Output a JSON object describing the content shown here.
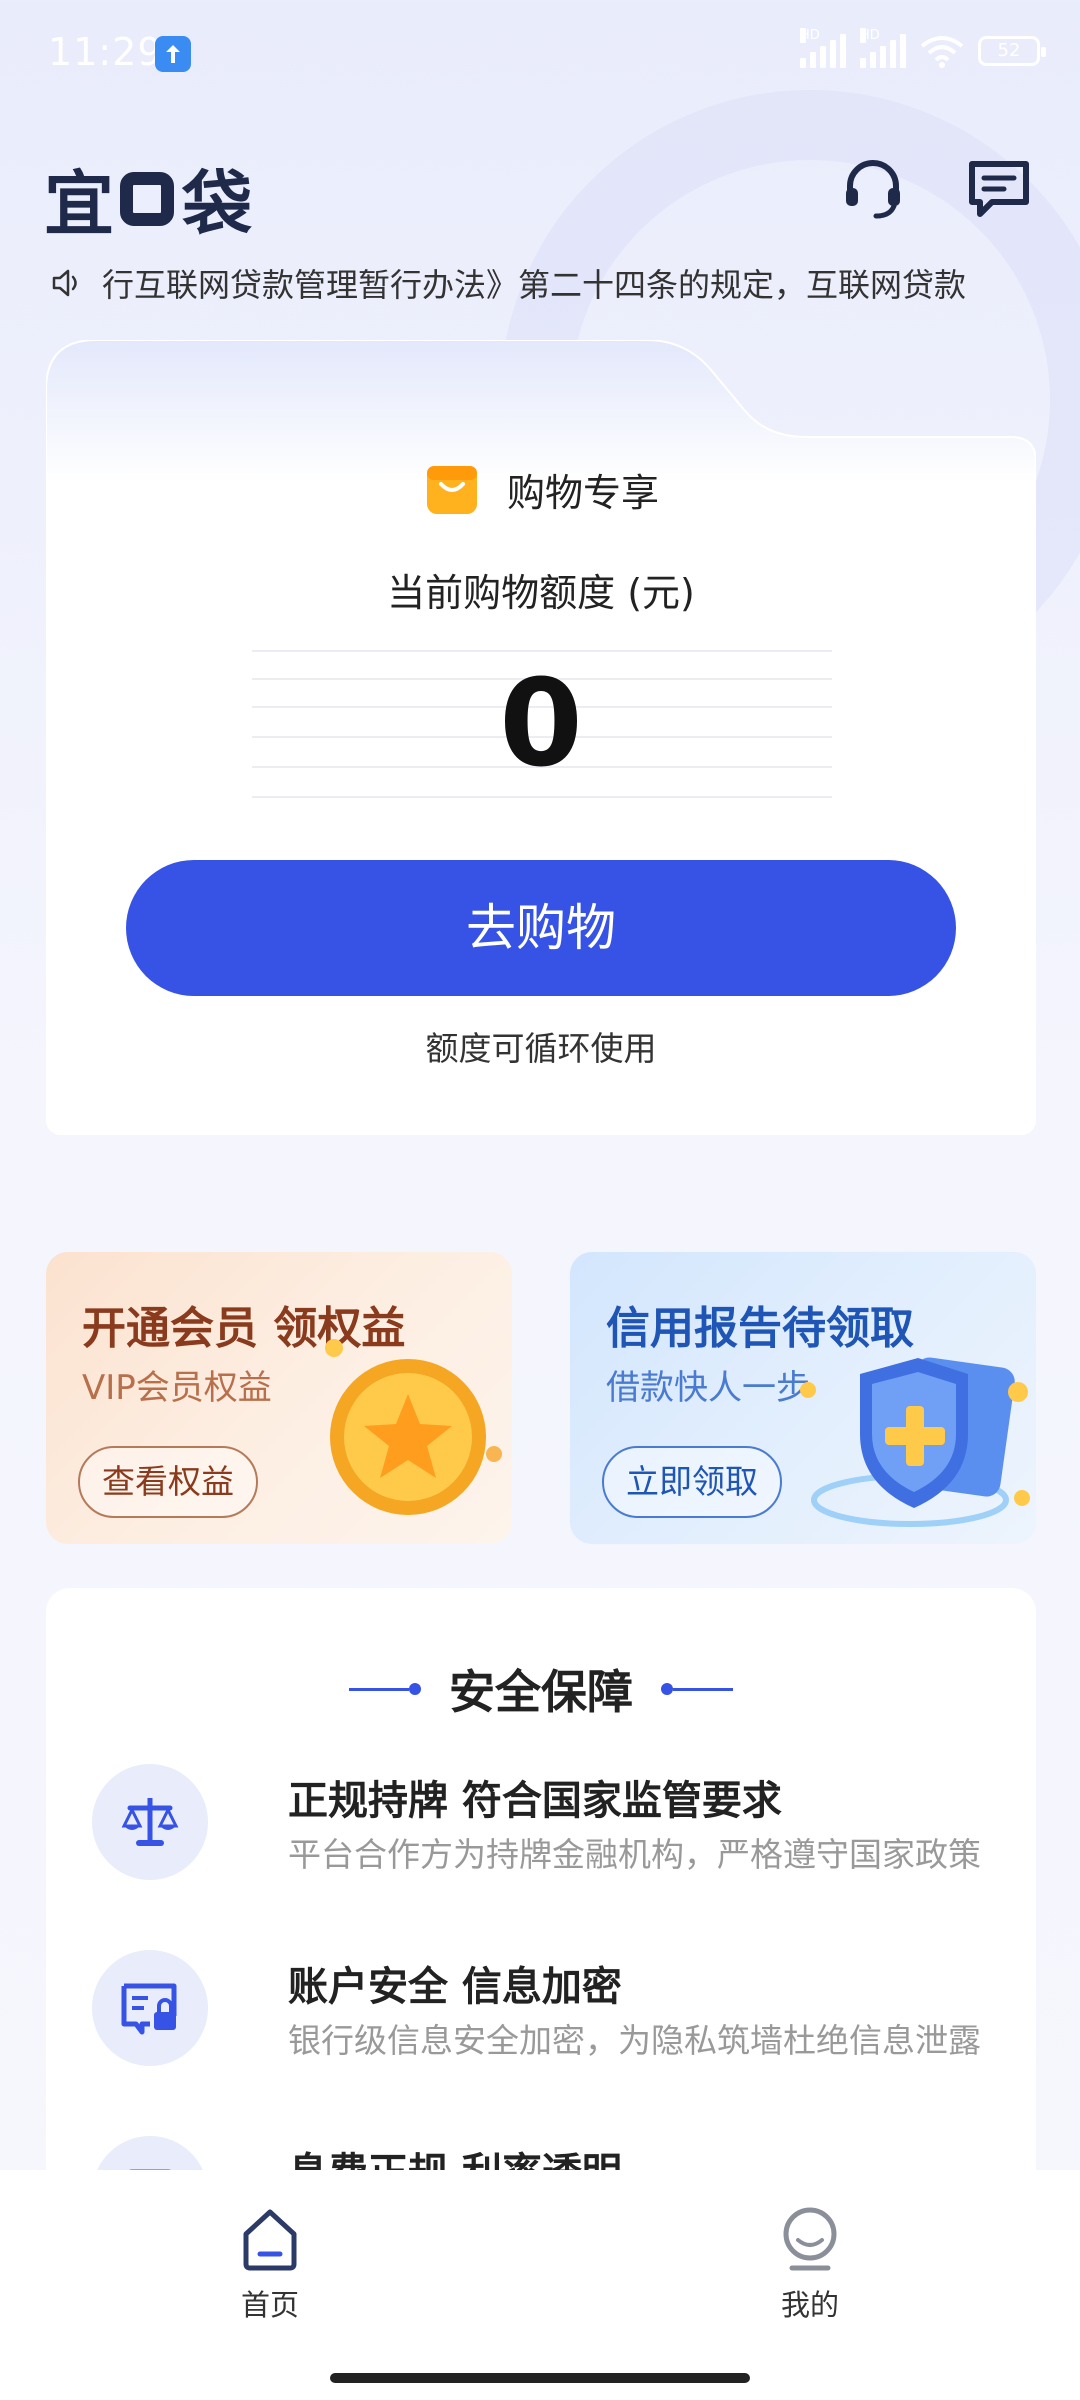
{
  "status_bar": {
    "time": "11:29",
    "battery": "52",
    "signal_1_label": "HD",
    "signal_2_label": "HD"
  },
  "header": {
    "logo_left": "宜",
    "logo_right": "袋",
    "icons": [
      "headset-icon",
      "message-icon"
    ]
  },
  "notice": {
    "text": "行互联网贷款管理暂行办法》第二十四条的规定，互联网贷款"
  },
  "quota_card": {
    "tag_label": "购物专享",
    "title": "当前购物额度 (元)",
    "amount": "0",
    "button_label": "去购物",
    "note": "额度可循环使用"
  },
  "promos": [
    {
      "title": "开通会员 领权益",
      "subtitle": "VIP会员权益",
      "button": "查看权益"
    },
    {
      "title": "信用报告待领取",
      "subtitle": "借款快人一步",
      "button": "立即领取"
    }
  ],
  "safety": {
    "title": "安全保障",
    "items": [
      {
        "icon": "scale-icon",
        "title": "正规持牌 符合国家监管要求",
        "desc": "平台合作方为持牌金融机构，严格遵守国家政策"
      },
      {
        "icon": "id-card-lock-icon",
        "title": "账户安全 信息加密",
        "desc": "银行级信息安全加密，为隐私筑墙杜绝信息泄露"
      },
      {
        "icon": "fee-icon",
        "title": "息费正规 利率透明",
        "desc": ""
      }
    ]
  },
  "bottom_nav": {
    "items": [
      {
        "label": "首页",
        "icon": "home-icon",
        "active": true
      },
      {
        "label": "我的",
        "icon": "profile-icon",
        "active": false
      }
    ]
  },
  "colors": {
    "primary": "#3653e6",
    "text_dark": "#222222",
    "text_muted": "#999999",
    "vip_accent": "#8a3b1d",
    "credit_accent": "#1f55b4"
  }
}
